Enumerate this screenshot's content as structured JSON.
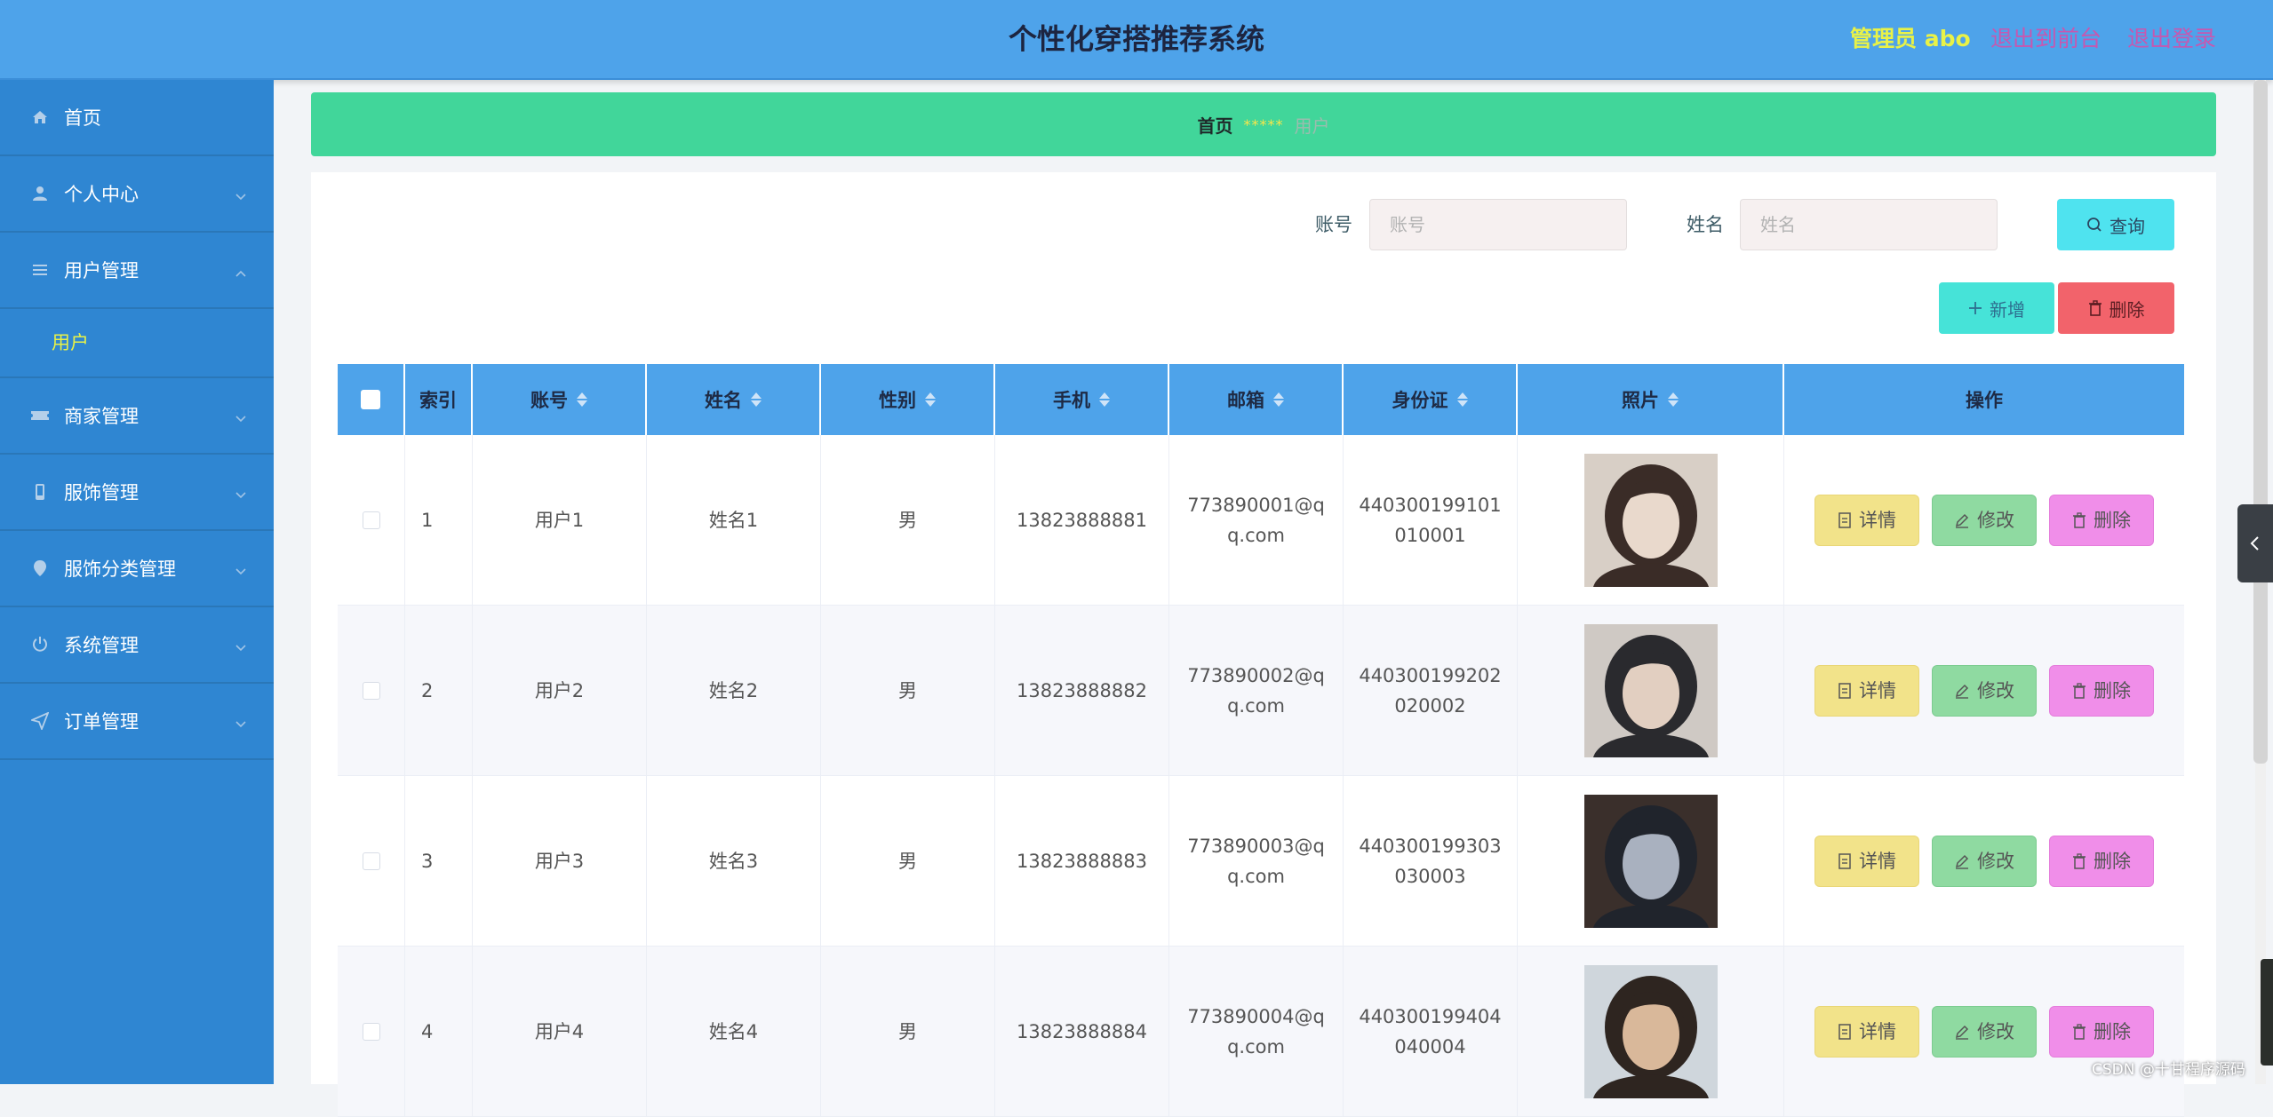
{
  "header": {
    "title": "个性化穿搭推荐系统",
    "admin": "管理员 abo",
    "to_front": "退出到前台",
    "logout": "退出登录"
  },
  "sidebar": {
    "items": [
      {
        "label": "首页",
        "icon": "home-icon",
        "expandable": false
      },
      {
        "label": "个人中心",
        "icon": "user-icon",
        "expandable": true
      },
      {
        "label": "用户管理",
        "icon": "menu-icon",
        "expandable": true,
        "expanded": true,
        "children": [
          "用户"
        ]
      },
      {
        "label": "商家管理",
        "icon": "ticket-icon",
        "expandable": true
      },
      {
        "label": "服饰管理",
        "icon": "phone-icon",
        "expandable": true
      },
      {
        "label": "服饰分类管理",
        "icon": "location-icon",
        "expandable": true
      },
      {
        "label": "系统管理",
        "icon": "power-icon",
        "expandable": true
      },
      {
        "label": "订单管理",
        "icon": "send-icon",
        "expandable": true
      }
    ]
  },
  "breadcrumb": {
    "home": "首页",
    "separator": "*****",
    "current": "用户"
  },
  "search": {
    "account_label": "账号",
    "account_placeholder": "账号",
    "name_label": "姓名",
    "name_placeholder": "姓名",
    "query_button": "查询"
  },
  "actions": {
    "add": "新增",
    "delete": "删除"
  },
  "table": {
    "columns": [
      "",
      "索引",
      "账号",
      "姓名",
      "性别",
      "手机",
      "邮箱",
      "身份证",
      "照片",
      "操作"
    ],
    "rows": [
      {
        "index": "1",
        "account": "用户1",
        "name": "姓名1",
        "gender": "男",
        "phone": "13823888881",
        "email": "773890001@qq.com",
        "id_card": "440300199101010001",
        "photo_colors": [
          "#d8cfc6",
          "#3a2c27",
          "#e9d9cc"
        ]
      },
      {
        "index": "2",
        "account": "用户2",
        "name": "姓名2",
        "gender": "男",
        "phone": "13823888882",
        "email": "773890002@qq.com",
        "id_card": "440300199202020002",
        "photo_colors": [
          "#cfc9c4",
          "#2a2a2e",
          "#e2cfc1"
        ]
      },
      {
        "index": "3",
        "account": "用户3",
        "name": "姓名3",
        "gender": "男",
        "phone": "13823888883",
        "email": "773890003@qq.com",
        "id_card": "440300199303030003",
        "photo_colors": [
          "#3a2f2b",
          "#20242c",
          "#a9b1bf"
        ]
      },
      {
        "index": "4",
        "account": "用户4",
        "name": "姓名4",
        "gender": "男",
        "phone": "13823888884",
        "email": "773890004@qq.com",
        "id_card": "440300199404040004",
        "photo_colors": [
          "#cfd6dc",
          "#2e2520",
          "#d9b89a"
        ]
      }
    ],
    "row_actions": {
      "detail": "详情",
      "edit": "修改",
      "delete": "删除"
    }
  },
  "watermark": "CSDN @十甘程序源码",
  "colors": {
    "header": "#4ea3ea",
    "sidebar": "#2f86d2",
    "breadcrumb": "#41d69a",
    "accent_yellow": "#e9f247",
    "logout_pink": "#c658b0",
    "add_button": "#46e3d8",
    "delete_button": "#f2636b"
  }
}
